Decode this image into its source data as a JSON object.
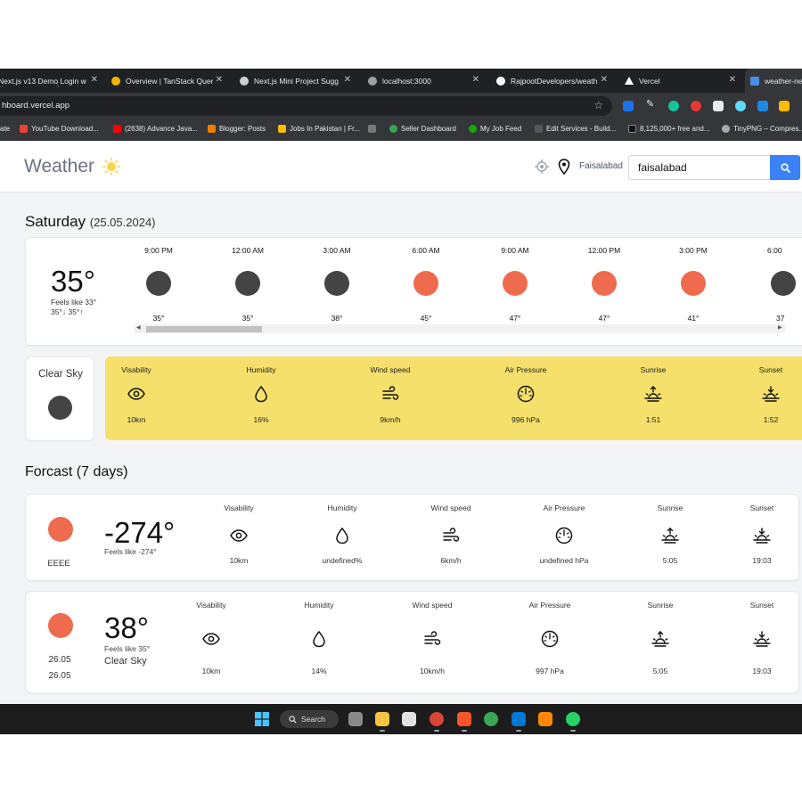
{
  "browser": {
    "tabs": [
      {
        "title": "Next.js v13 Demo Login w",
        "color": "#ffffff"
      },
      {
        "title": "Overview | TanStack Quer",
        "color": "#f4b400"
      },
      {
        "title": "Next.js Mini Project Sugg",
        "color": "#cfcfcf"
      },
      {
        "title": "localhost:3000",
        "color": "#9aa0a6"
      },
      {
        "title": "RajpootDevelopers/weath",
        "color": "#ffffff"
      },
      {
        "title": "Vercel",
        "color": "#ffffff"
      },
      {
        "title": "weather-ne",
        "color": "#4a90e2"
      }
    ],
    "url": "hboard.vercel.app",
    "bookmarks": [
      {
        "label": "ate",
        "color": "#888888"
      },
      {
        "label": "YouTube Download...",
        "color": "#ea4335"
      },
      {
        "label": "(2638) Advance Java...",
        "color": "#ff0000"
      },
      {
        "label": "Blogger: Posts",
        "color": "#f57c00"
      },
      {
        "label": "Jobs In Pakistan | Fr...",
        "color": "#fbbc04"
      },
      {
        "label": "Seller Dashboard",
        "color": "#34a853"
      },
      {
        "label": "My Job Feed",
        "color": "#14a800"
      },
      {
        "label": "Edit Services - Build...",
        "color": "#cccccc"
      },
      {
        "label": "8,125,000+ free and...",
        "color": "#222222"
      },
      {
        "label": "TinyPNG – Compres...",
        "color": "#aaaaaa"
      }
    ]
  },
  "app": {
    "title": "Weather",
    "location": "Faisalabad",
    "search_value": "faisalabad"
  },
  "today": {
    "day": "Saturday",
    "date": "(25.05.2024)",
    "temp": "35°",
    "feels_like": "Feels like 33°",
    "min_max": "35°↓   35°↑",
    "hourly": [
      {
        "time": "9:00 PM",
        "temp": "35°",
        "color": "#444444"
      },
      {
        "time": "12:00 AM",
        "temp": "35°",
        "color": "#444444"
      },
      {
        "time": "3:00 AM",
        "temp": "38°",
        "color": "#444444"
      },
      {
        "time": "6:00 AM",
        "temp": "45°",
        "color": "#ee6b4d"
      },
      {
        "time": "9:00 AM",
        "temp": "47°",
        "color": "#ee6b4d"
      },
      {
        "time": "12:00 PM",
        "temp": "47°",
        "color": "#ee6b4d"
      },
      {
        "time": "3:00 PM",
        "temp": "41°",
        "color": "#ee6b4d"
      },
      {
        "time": "6:00",
        "temp": "37",
        "color": "#444444"
      }
    ],
    "condition": "Clear Sky",
    "stats": [
      {
        "label": "Visability",
        "value": "10km",
        "icon": "eye-icon"
      },
      {
        "label": "Humidity",
        "value": "16%",
        "icon": "droplet-icon"
      },
      {
        "label": "Wind speed",
        "value": "9km/h",
        "icon": "wind-icon"
      },
      {
        "label": "Air Pressure",
        "value": "996 hPa",
        "icon": "gauge-icon"
      },
      {
        "label": "Sunrise",
        "value": "1:51",
        "icon": "sunrise-icon"
      },
      {
        "label": "Sunset",
        "value": "1:52",
        "icon": "sunset-icon"
      }
    ]
  },
  "forecast": {
    "heading": "Forcast (7 days)",
    "items": [
      {
        "day": "EEEE",
        "date": "",
        "temp": "-274°",
        "feels_like": "Feels like -274°",
        "description": "",
        "stats": [
          {
            "label": "Visability",
            "value": "10km"
          },
          {
            "label": "Humidity",
            "value": "undefined%"
          },
          {
            "label": "Wind speed",
            "value": "6km/h"
          },
          {
            "label": "Air Pressure",
            "value": "undefined hPa"
          },
          {
            "label": "Sunrise",
            "value": "5:05"
          },
          {
            "label": "Sunset",
            "value": "19:03"
          }
        ]
      },
      {
        "day": "26.05",
        "date": "26.05",
        "temp": "38°",
        "feels_like": "Feels like 35°",
        "description": "Clear Sky",
        "stats": [
          {
            "label": "Visability",
            "value": "10km"
          },
          {
            "label": "Humidity",
            "value": "14%"
          },
          {
            "label": "Wind speed",
            "value": "10km/h"
          },
          {
            "label": "Air Pressure",
            "value": "997 hPa"
          },
          {
            "label": "Sunrise",
            "value": "5:05"
          },
          {
            "label": "Sunset",
            "value": "19:03"
          }
        ]
      }
    ]
  },
  "taskbar": {
    "search_label": "Search"
  },
  "colors": {
    "accent_blue": "#3b82f6",
    "stats_panel": "#f5e06b",
    "sun_orange": "#ee6b4d",
    "moon_dark": "#444444",
    "logo_sun": "#fcd34d"
  }
}
